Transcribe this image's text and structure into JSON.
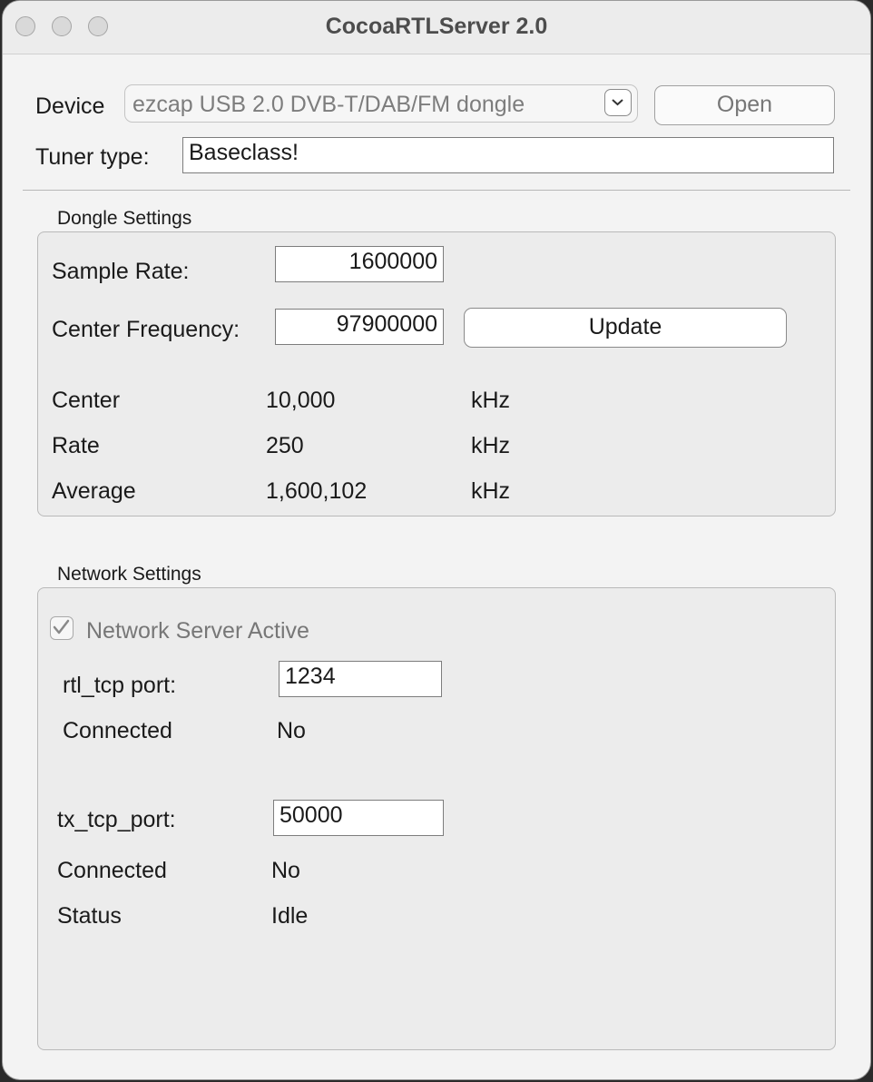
{
  "window": {
    "title": "CocoaRTLServer 2.0"
  },
  "device": {
    "label": "Device",
    "selected": "ezcap USB 2.0 DVB-T/DAB/FM dongle",
    "open_label": "Open",
    "tuner_label": "Tuner type:",
    "tuner_value": "Baseclass!"
  },
  "dongle": {
    "section_title": "Dongle Settings",
    "sample_rate_label": "Sample Rate:",
    "sample_rate_value": "1600000",
    "center_freq_label": "Center Frequency:",
    "center_freq_value": "97900000",
    "update_label": "Update",
    "stats": [
      {
        "label": "Center",
        "value": "10,000",
        "unit": "kHz"
      },
      {
        "label": "Rate",
        "value": "250",
        "unit": "kHz"
      },
      {
        "label": "Average",
        "value": "1,600,102",
        "unit": "kHz"
      }
    ]
  },
  "network": {
    "section_title": "Network Settings",
    "server_active_label": "Network Server Active",
    "server_active_checked": true,
    "rtl_port_label": "rtl_tcp port:",
    "rtl_port_value": "1234",
    "rtl_connected_label": "Connected",
    "rtl_connected_value": "No",
    "tx_port_label": "tx_tcp_port:",
    "tx_port_value": "50000",
    "tx_connected_label": "Connected",
    "tx_connected_value": "No",
    "status_label": "Status",
    "status_value": "Idle"
  }
}
